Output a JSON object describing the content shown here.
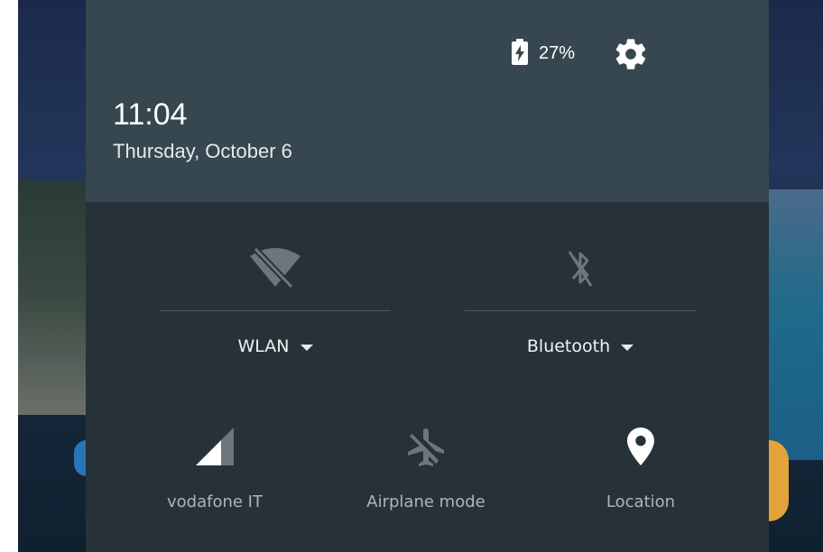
{
  "status": {
    "battery_percent": "27%",
    "battery_charging": true
  },
  "header": {
    "time": "11:04",
    "date": "Thursday, October 6"
  },
  "tiles": {
    "wlan": {
      "label": "WLAN",
      "enabled": false,
      "icon": "wifi-off-icon"
    },
    "bluetooth": {
      "label": "Bluetooth",
      "enabled": false,
      "icon": "bluetooth-off-icon"
    },
    "cellular": {
      "label": "vodafone IT",
      "icon": "cellular-signal-icon"
    },
    "airplane": {
      "label": "Airplane mode",
      "enabled": false,
      "icon": "airplane-off-icon"
    },
    "location": {
      "label": "Location",
      "enabled": true,
      "icon": "location-pin-icon"
    }
  },
  "colors": {
    "header_bg": "#37474f",
    "panel_bg": "#263238",
    "icon_active": "#ffffff",
    "icon_inactive": "#6b777c"
  }
}
